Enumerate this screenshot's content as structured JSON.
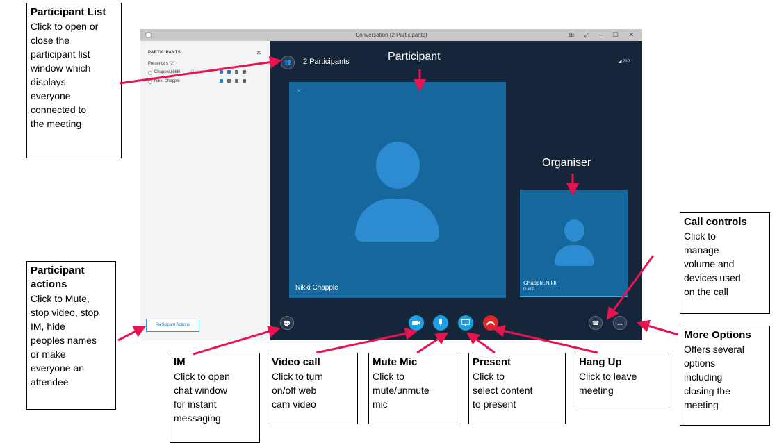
{
  "window": {
    "title": "Conversation (2 Participants)",
    "controls": "⊞ ⤢ – ☐ ✕"
  },
  "participants_panel": {
    "header": "PARTICIPANTS",
    "close": "✕",
    "presenters_label": "Presenters (2)",
    "rows": [
      {
        "name": "Chapple,Nikki",
        "tag": "Guest"
      },
      {
        "name": "Nikki Chapple",
        "tag": ""
      }
    ],
    "actions_button": "Participant Actions"
  },
  "stage": {
    "participants_count": "2 Participants",
    "signal": "◢ 210",
    "main_video_name": "Nikki Chapple",
    "small_video_name": "Chapple,Nikki",
    "small_video_sub": "Guest"
  },
  "overlay_labels": {
    "participant": "Participant",
    "organiser": "Organiser"
  },
  "callouts": {
    "participant_list": {
      "title": "Participant List",
      "text": "Click to open or\nclose the\nparticipant list\nwindow which\ndisplays\neveryone\nconnected to\nthe meeting"
    },
    "participant_actions": {
      "title": "Participant\nactions",
      "text": "Click to Mute,\nstop video, stop\nIM,  hide\npeoples names\nor make\neveryone an\nattendee"
    },
    "im": {
      "title": "IM",
      "text": "Click to open\nchat window\nfor instant\nmessaging"
    },
    "video_call": {
      "title": "Video call",
      "text": "Click to turn\non/off web\ncam video"
    },
    "mute_mic": {
      "title": "Mute Mic",
      "text": " Click to\nmute/unmute\nmic"
    },
    "present": {
      "title": "Present",
      "text": " Click to\nselect content\nto present"
    },
    "hang_up": {
      "title": "Hang Up",
      "text": "Click to leave\nmeeting"
    },
    "call_controls": {
      "title": "Call controls",
      "text": "Click to\nmanage\nvolume and\ndevices used\non the call"
    },
    "more_options": {
      "title": "More Options",
      "text": "Offers several\noptions\nincluding\nclosing the\nmeeting"
    }
  },
  "colors": {
    "accent": "#1da0e3",
    "hangup": "#d8262a",
    "arrow": "#e8134f",
    "stage_bg": "#16263a",
    "video_tile": "#15679c"
  },
  "icons": {
    "participants": "people-icon",
    "im": "chat-bubble-icon",
    "video": "camera-icon",
    "mic": "microphone-icon",
    "present": "monitor-icon",
    "hangup": "phone-hangup-icon",
    "call_controls": "phone-keypad-icon",
    "more": "ellipsis-icon"
  }
}
